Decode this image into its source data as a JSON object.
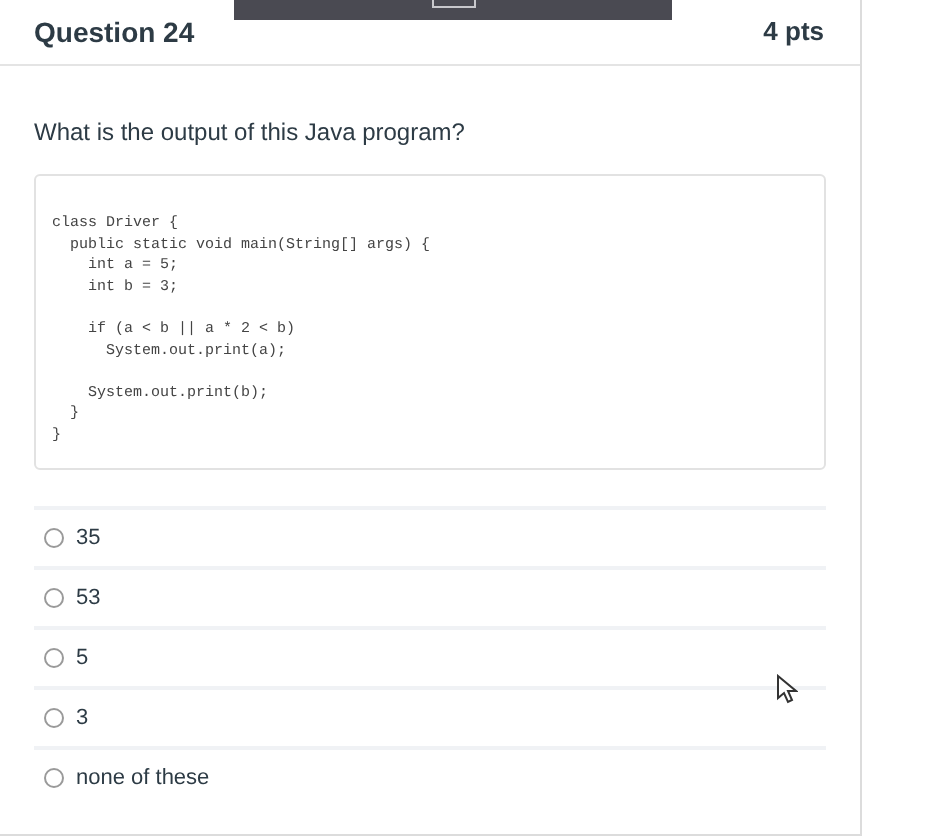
{
  "question": {
    "title": "Question 24",
    "points": "4 pts"
  },
  "prompt": "What is the output of this Java program?",
  "code": "class Driver {\n  public static void main(String[] args) {\n    int a = 5;\n    int b = 3;\n\n    if (a < b || a * 2 < b)\n      System.out.print(a);\n\n    System.out.print(b);\n  }\n}",
  "answers": [
    {
      "label": "35",
      "selected": false
    },
    {
      "label": "53",
      "selected": false
    },
    {
      "label": "5",
      "selected": false
    },
    {
      "label": "3",
      "selected": false
    },
    {
      "label": "none of these",
      "selected": false
    }
  ]
}
